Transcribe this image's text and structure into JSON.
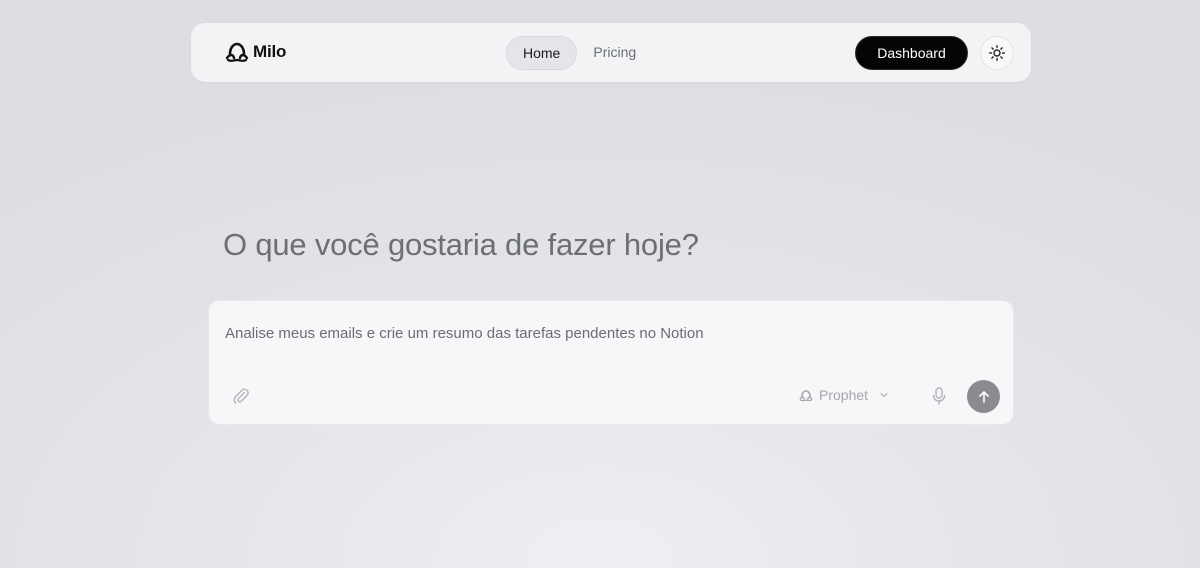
{
  "nav": {
    "brand": "Milo",
    "links": [
      {
        "label": "Home",
        "active": true
      },
      {
        "label": "Pricing",
        "active": false
      }
    ],
    "dashboard_label": "Dashboard",
    "theme_icon": "sun-icon"
  },
  "main": {
    "headline": "O que você gostaria de fazer hoje?"
  },
  "composer": {
    "placeholder": "Analise meus emails e crie um resumo das tarefas pendentes no Notion",
    "model_label": "Prophet",
    "icons": [
      "paperclip-icon",
      "mic-icon",
      "arrow-up-icon",
      "chevron-down-icon"
    ]
  },
  "colors": {
    "primary_button": "#050505",
    "send_button": "#8a8b8e",
    "background": "#e2e4e8"
  }
}
